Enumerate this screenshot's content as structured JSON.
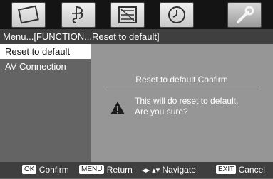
{
  "tabs": [
    {
      "icon": "picture-icon"
    },
    {
      "icon": "music-note-icon"
    },
    {
      "icon": "setup-icon"
    },
    {
      "icon": "clock-icon"
    },
    {
      "icon": "function-icon"
    }
  ],
  "breadcrumb": "Menu...[FUNCTION...Reset to default]",
  "sidebar": {
    "items": [
      {
        "label": "Reset to default"
      },
      {
        "label": "AV Connection"
      }
    ]
  },
  "dialog": {
    "title": "Reset to default Confirm",
    "message_line1": "This will do reset to default.",
    "message_line2": "Are you sure?"
  },
  "footer": {
    "ok_key": "OK",
    "ok_label": "Confirm",
    "menu_key": "MENU",
    "menu_label": "Return",
    "nav_glyph": "◂▸ ▴▾",
    "nav_label": "Navigate",
    "exit_key": "EXIT",
    "exit_label": "Cancel"
  },
  "colors": {
    "background": "#646464",
    "content_panel": "#969696",
    "bar": "#3f3f3f",
    "topbar": "#141414",
    "highlight": "#ffffff"
  }
}
